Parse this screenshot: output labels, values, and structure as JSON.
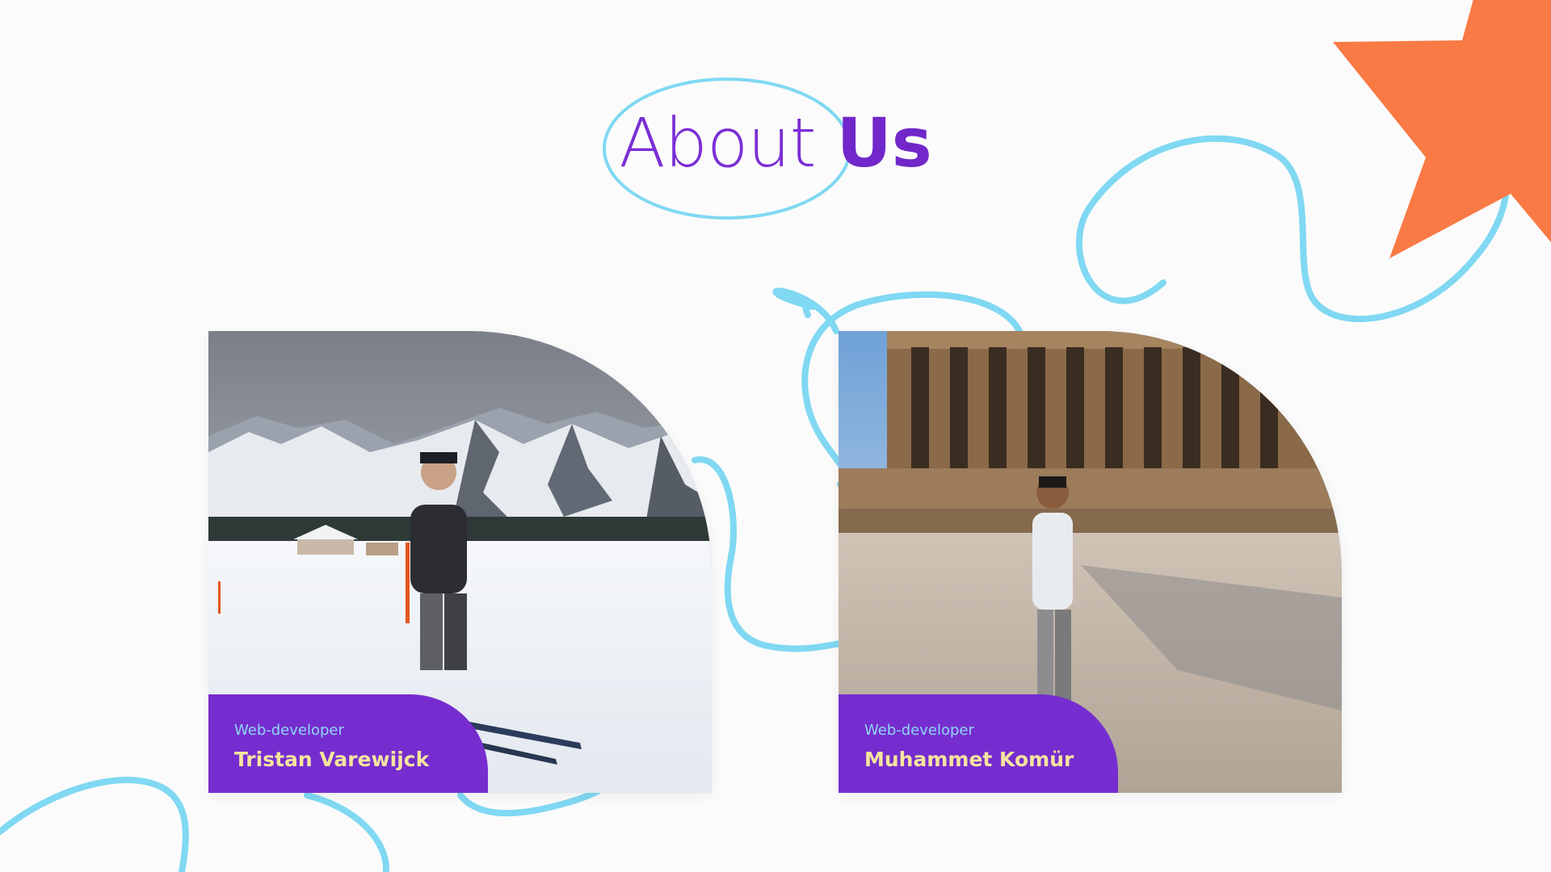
{
  "heading": {
    "light_word": "About",
    "bold_word": "Us"
  },
  "team": [
    {
      "role": "Web-developer",
      "name": "Tristan Varewijck",
      "photo": "skier-in-snowy-mountains"
    },
    {
      "role": "Web-developer",
      "name": "Muhammet Komür",
      "photo": "man-at-colonnaded-monument"
    }
  ],
  "colors": {
    "accent_purple": "#762dcf",
    "heading_purple": "#7127c9",
    "squiggle_blue": "#80d8f2",
    "star_orange": "#f97a45",
    "name_yellow": "#f5e49e",
    "role_blue": "#8fd6f4"
  },
  "icons": [
    "orange-star-icon",
    "blue-squiggle-lines"
  ]
}
